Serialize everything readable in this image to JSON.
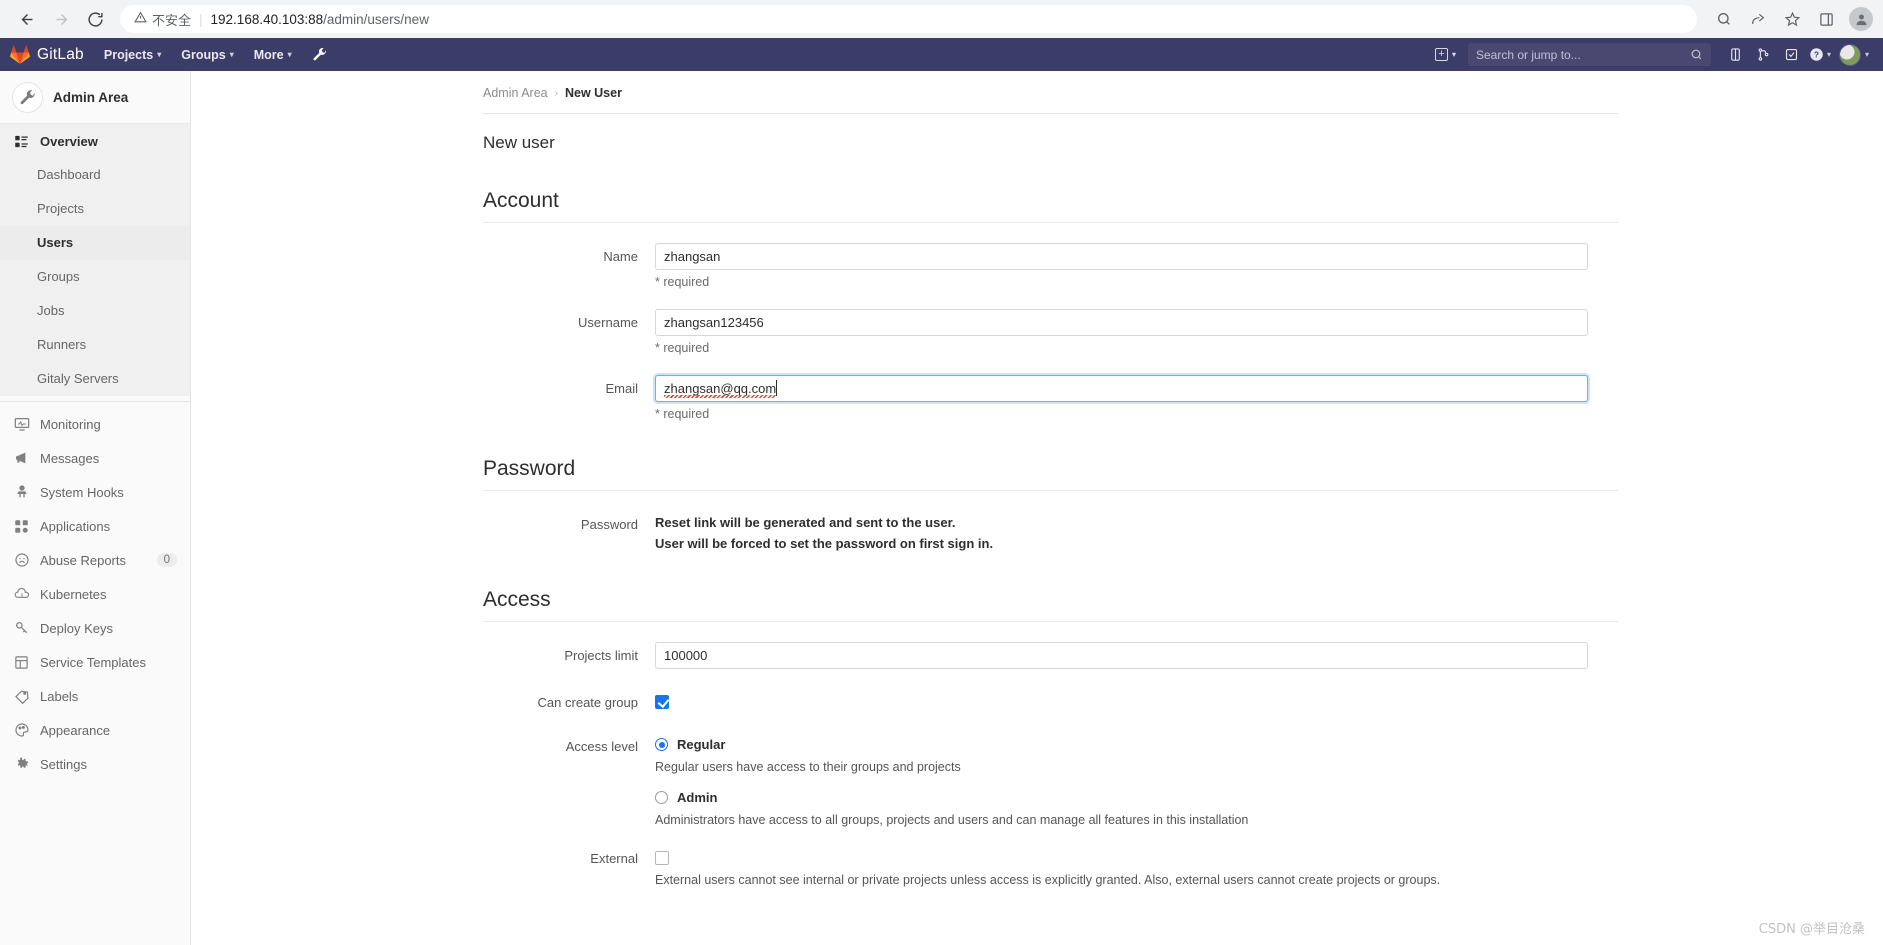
{
  "browser": {
    "back_icon": "arrow-left-icon",
    "forward_icon": "arrow-right-icon",
    "reload_icon": "reload-icon",
    "security_warning": "不安全",
    "url_host": "192.168.40.103:88",
    "url_path": "/admin/users/new",
    "toolbar_icons": [
      "search-icon",
      "share-icon",
      "bookmark-star-icon",
      "side-panel-icon",
      "profile-avatar-icon"
    ]
  },
  "navbar": {
    "brand": "GitLab",
    "links": [
      {
        "label": "Projects",
        "caret": "▾"
      },
      {
        "label": "Groups",
        "caret": "▾"
      },
      {
        "label": "More",
        "caret": "▾"
      }
    ],
    "admin_wrench_icon": "wrench-icon",
    "plus_label": "+",
    "search_placeholder": "Search or jump to...",
    "right_icons": [
      "issues-icon",
      "merge-requests-icon",
      "todos-icon",
      "help-icon"
    ],
    "help_caret": "▾",
    "avatar_caret": "▾",
    "bg_color": "#3c3c68"
  },
  "sidebar": {
    "title": "Admin Area",
    "avatar_icon": "wrench-icon",
    "overview": {
      "label": "Overview",
      "icon": "overview-list-icon",
      "items": [
        {
          "label": "Dashboard",
          "active": false
        },
        {
          "label": "Projects",
          "active": false
        },
        {
          "label": "Users",
          "active": true
        },
        {
          "label": "Groups",
          "active": false
        },
        {
          "label": "Jobs",
          "active": false
        },
        {
          "label": "Runners",
          "active": false
        },
        {
          "label": "Gitaly Servers",
          "active": false
        }
      ]
    },
    "items": [
      {
        "label": "Monitoring",
        "icon": "monitor-icon",
        "badge": null
      },
      {
        "label": "Messages",
        "icon": "megaphone-icon",
        "badge": null
      },
      {
        "label": "System Hooks",
        "icon": "hook-icon",
        "badge": null
      },
      {
        "label": "Applications",
        "icon": "apps-grid-icon",
        "badge": null
      },
      {
        "label": "Abuse Reports",
        "icon": "frown-face-icon",
        "badge": "0"
      },
      {
        "label": "Kubernetes",
        "icon": "kubernetes-icon",
        "badge": null
      },
      {
        "label": "Deploy Keys",
        "icon": "key-icon",
        "badge": null
      },
      {
        "label": "Service Templates",
        "icon": "template-layout-icon",
        "badge": null
      },
      {
        "label": "Labels",
        "icon": "label-tag-icon",
        "badge": null
      },
      {
        "label": "Appearance",
        "icon": "palette-icon",
        "badge": null
      },
      {
        "label": "Settings",
        "icon": "gear-icon",
        "badge": null
      }
    ]
  },
  "main": {
    "breadcrumb": {
      "root": "Admin Area",
      "separator": "›",
      "current": "New User"
    },
    "page_title": "New user",
    "sections": {
      "account": {
        "title": "Account",
        "name": {
          "label": "Name",
          "value": "zhangsan",
          "hint": "* required"
        },
        "username": {
          "label": "Username",
          "value": "zhangsan123456",
          "hint": "* required"
        },
        "email": {
          "label": "Email",
          "value": "zhangsan@qq.com",
          "hint": "* required",
          "focused": true
        }
      },
      "password": {
        "title": "Password",
        "label": "Password",
        "note_line1": "Reset link will be generated and sent to the user.",
        "note_line2": "User will be forced to set the password on first sign in."
      },
      "access": {
        "title": "Access",
        "projects_limit": {
          "label": "Projects limit",
          "value": "100000"
        },
        "can_create_group": {
          "label": "Can create group",
          "checked": true
        },
        "access_level": {
          "label": "Access level",
          "options": [
            {
              "label": "Regular",
              "selected": true,
              "desc": "Regular users have access to their groups and projects"
            },
            {
              "label": "Admin",
              "selected": false,
              "desc": "Administrators have access to all groups, projects and users and can manage all features in this installation"
            }
          ]
        },
        "external": {
          "label": "External",
          "checked": false,
          "desc": "External users cannot see internal or private projects unless access is explicitly granted. Also, external users cannot create projects or groups."
        }
      }
    }
  },
  "watermark": "CSDN @举目沧桑"
}
